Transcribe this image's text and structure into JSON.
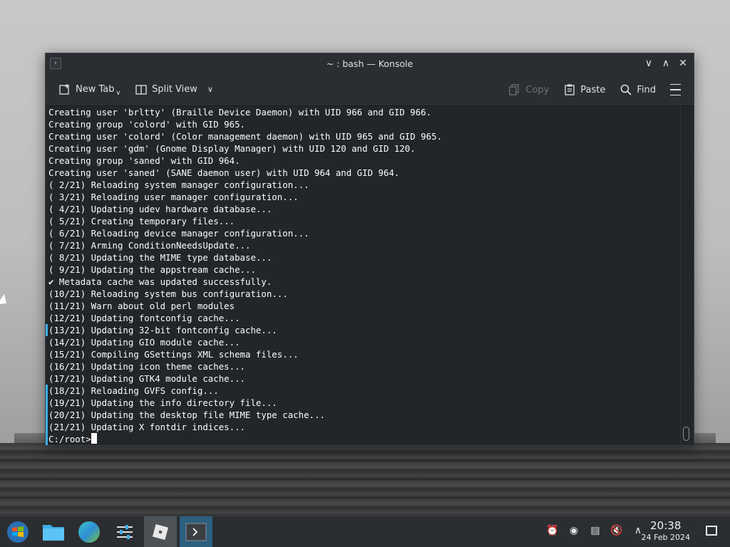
{
  "window": {
    "title": "~ : bash — Konsole",
    "controls": [
      "minimize",
      "maximize",
      "close"
    ]
  },
  "toolbar": {
    "new_tab": "New Tab",
    "split_view": "Split View",
    "copy": "Copy",
    "paste": "Paste",
    "find": "Find"
  },
  "terminal": {
    "lines": [
      "Creating user 'brltty' (Braille Device Daemon) with UID 966 and GID 966.",
      "Creating group 'colord' with GID 965.",
      "Creating user 'colord' (Color management daemon) with UID 965 and GID 965.",
      "Creating user 'gdm' (Gnome Display Manager) with UID 120 and GID 120.",
      "Creating group 'saned' with GID 964.",
      "Creating user 'saned' (SANE daemon user) with UID 964 and GID 964.",
      "( 2/21) Reloading system manager configuration...",
      "( 3/21) Reloading user manager configuration...",
      "( 4/21) Updating udev hardware database...",
      "( 5/21) Creating temporary files...",
      "( 6/21) Reloading device manager configuration...",
      "( 7/21) Arming ConditionNeedsUpdate...",
      "( 8/21) Updating the MIME type database...",
      "( 9/21) Updating the appstream cache...",
      "✔ Metadata cache was updated successfully.",
      "(10/21) Reloading system bus configuration...",
      "(11/21) Warn about old perl modules",
      "(12/21) Updating fontconfig cache...",
      "(13/21) Updating 32-bit fontconfig cache...",
      "(14/21) Updating GIO module cache...",
      "(15/21) Compiling GSettings XML schema files...",
      "(16/21) Updating icon theme caches...",
      "(17/21) Updating GTK4 module cache...",
      "(18/21) Reloading GVFS config...",
      "(19/21) Updating the info directory file...",
      "(20/21) Updating the desktop file MIME type cache...",
      "(21/21) Updating X fontdir indices..."
    ],
    "prompt": "C:/root>"
  },
  "taskbar": {
    "apps": [
      "start-menu-icon",
      "file-manager-icon",
      "browser-icon",
      "system-settings-icon",
      "roblox-icon",
      "konsole-icon"
    ],
    "tray": [
      "notifications-icon",
      "updates-icon",
      "clipboard-icon",
      "volume-muted-icon",
      "tray-expand-icon"
    ],
    "clock": {
      "time": "20:38",
      "date": "24 Feb 2024"
    }
  },
  "colors": {
    "terminal_bg": "#232629",
    "terminal_fg": "#fcfcfc",
    "accent": "#3daee9",
    "taskbar_bg": "#2b2e31"
  }
}
